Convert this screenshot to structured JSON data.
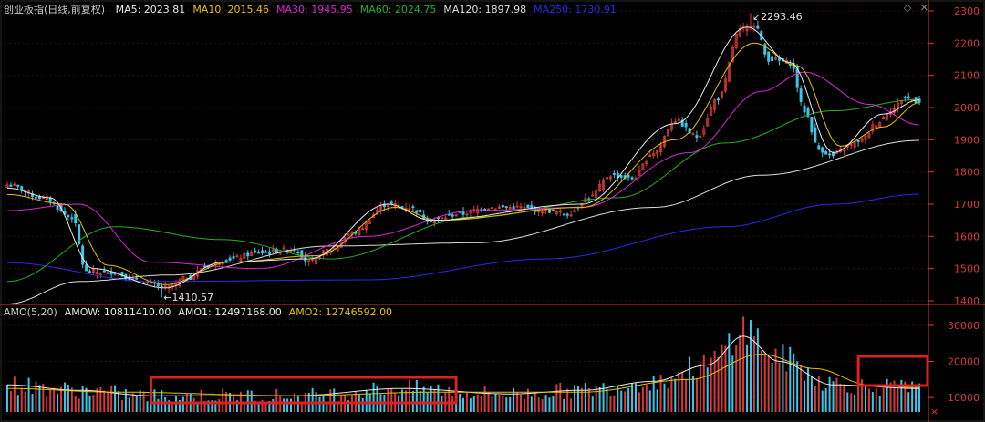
{
  "index_name": "创业板指",
  "period_label": "(日线,前复权)",
  "ma_legend": [
    {
      "label": "MA5: 2023.81",
      "color": "#e8e8e8"
    },
    {
      "label": "MA10: 2015.46",
      "color": "#e5c000"
    },
    {
      "label": "MA30: 1945.95",
      "color": "#d22ad2"
    },
    {
      "label": "MA60: 2024.75",
      "color": "#22b022"
    },
    {
      "label": "MA120: 1897.98",
      "color": "#dcdcdc"
    },
    {
      "label": "MA250: 1730.91",
      "color": "#2a2ae8"
    }
  ],
  "amo_legend": [
    {
      "label": "AMO(5,20)",
      "color": "#c8c8c8"
    },
    {
      "label": "AMOW: 10811410.00",
      "color": "#e8e8e8"
    },
    {
      "label": "AMO1: 12497168.00",
      "color": "#e8e8e8"
    },
    {
      "label": "AMO2: 12746592.00",
      "color": "#e5c000"
    }
  ],
  "icons": [
    "diamond-icon",
    "close-icon"
  ],
  "icon_glyphs": {
    "diamond": "◇",
    "close": "✕"
  },
  "annotations": {
    "high": "2293.46",
    "low": "1410.57"
  },
  "colors": {
    "up": "#d63a3a",
    "down": "#3ec5e8",
    "axis": "#d63a3a",
    "grid": "#3a0d0d",
    "highlight": "#e02020"
  },
  "chart_data": [
    {
      "type": "candlestick",
      "title": "创业板指 (日线,前复权)",
      "ylim": [
        1400,
        2300
      ],
      "yticks": [
        1400,
        1500,
        1600,
        1700,
        1800,
        1900,
        2000,
        2100,
        2200,
        2300
      ],
      "keypoints_close": [
        {
          "i": 0,
          "v": 1760
        },
        {
          "i": 10,
          "v": 1720
        },
        {
          "i": 18,
          "v": 1660
        },
        {
          "i": 22,
          "v": 1490
        },
        {
          "i": 28,
          "v": 1490
        },
        {
          "i": 38,
          "v": 1460
        },
        {
          "i": 44,
          "v": 1440
        },
        {
          "i": 50,
          "v": 1470
        },
        {
          "i": 56,
          "v": 1510
        },
        {
          "i": 62,
          "v": 1530
        },
        {
          "i": 70,
          "v": 1550
        },
        {
          "i": 80,
          "v": 1560
        },
        {
          "i": 84,
          "v": 1520
        },
        {
          "i": 90,
          "v": 1560
        },
        {
          "i": 96,
          "v": 1610
        },
        {
          "i": 106,
          "v": 1700
        },
        {
          "i": 112,
          "v": 1690
        },
        {
          "i": 118,
          "v": 1650
        },
        {
          "i": 126,
          "v": 1670
        },
        {
          "i": 134,
          "v": 1690
        },
        {
          "i": 142,
          "v": 1690
        },
        {
          "i": 150,
          "v": 1680
        },
        {
          "i": 156,
          "v": 1670
        },
        {
          "i": 162,
          "v": 1720
        },
        {
          "i": 168,
          "v": 1790
        },
        {
          "i": 174,
          "v": 1780
        },
        {
          "i": 180,
          "v": 1860
        },
        {
          "i": 186,
          "v": 1960
        },
        {
          "i": 192,
          "v": 1910
        },
        {
          "i": 198,
          "v": 2030
        },
        {
          "i": 204,
          "v": 2240
        },
        {
          "i": 208,
          "v": 2260
        },
        {
          "i": 212,
          "v": 2150
        },
        {
          "i": 218,
          "v": 2140
        },
        {
          "i": 222,
          "v": 1990
        },
        {
          "i": 226,
          "v": 1870
        },
        {
          "i": 230,
          "v": 1850
        },
        {
          "i": 234,
          "v": 1880
        },
        {
          "i": 238,
          "v": 1900
        },
        {
          "i": 242,
          "v": 1950
        },
        {
          "i": 246,
          "v": 1990
        },
        {
          "i": 250,
          "v": 2030
        },
        {
          "i": 254,
          "v": 2020
        }
      ],
      "high_point": {
        "value": 2293.46,
        "index": 207
      },
      "low_point": {
        "value": 1410.57,
        "index": 43
      },
      "moving_averages": [
        {
          "name": "MA250",
          "keypoints": [
            {
              "i": 0,
              "v": 1518
            },
            {
              "i": 40,
              "v": 1460
            },
            {
              "i": 100,
              "v": 1465
            },
            {
              "i": 150,
              "v": 1530
            },
            {
              "i": 200,
              "v": 1630
            },
            {
              "i": 230,
              "v": 1700
            },
            {
              "i": 254,
              "v": 1731
            }
          ]
        },
        {
          "name": "MA120",
          "keypoints": [
            {
              "i": 0,
              "v": 1390
            },
            {
              "i": 20,
              "v": 1460
            },
            {
              "i": 45,
              "v": 1480
            },
            {
              "i": 90,
              "v": 1570
            },
            {
              "i": 130,
              "v": 1580
            },
            {
              "i": 180,
              "v": 1690
            },
            {
              "i": 210,
              "v": 1790
            },
            {
              "i": 254,
              "v": 1898
            }
          ]
        },
        {
          "name": "MA60",
          "keypoints": [
            {
              "i": 0,
              "v": 1460
            },
            {
              "i": 30,
              "v": 1630
            },
            {
              "i": 60,
              "v": 1590
            },
            {
              "i": 90,
              "v": 1530
            },
            {
              "i": 130,
              "v": 1660
            },
            {
              "i": 170,
              "v": 1720
            },
            {
              "i": 200,
              "v": 1890
            },
            {
              "i": 230,
              "v": 1990
            },
            {
              "i": 254,
              "v": 2025
            }
          ]
        },
        {
          "name": "MA30",
          "keypoints": [
            {
              "i": 0,
              "v": 1680
            },
            {
              "i": 20,
              "v": 1700
            },
            {
              "i": 40,
              "v": 1520
            },
            {
              "i": 70,
              "v": 1500
            },
            {
              "i": 100,
              "v": 1600
            },
            {
              "i": 130,
              "v": 1680
            },
            {
              "i": 160,
              "v": 1690
            },
            {
              "i": 190,
              "v": 1860
            },
            {
              "i": 210,
              "v": 2050
            },
            {
              "i": 222,
              "v": 2110
            },
            {
              "i": 240,
              "v": 2010
            },
            {
              "i": 254,
              "v": 1946
            }
          ]
        },
        {
          "name": "MA10",
          "keypoints": [
            {
              "i": 0,
              "v": 1730
            },
            {
              "i": 16,
              "v": 1700
            },
            {
              "i": 28,
              "v": 1510
            },
            {
              "i": 44,
              "v": 1450
            },
            {
              "i": 62,
              "v": 1520
            },
            {
              "i": 86,
              "v": 1540
            },
            {
              "i": 108,
              "v": 1690
            },
            {
              "i": 120,
              "v": 1650
            },
            {
              "i": 160,
              "v": 1690
            },
            {
              "i": 186,
              "v": 1900
            },
            {
              "i": 208,
              "v": 2200
            },
            {
              "i": 220,
              "v": 2130
            },
            {
              "i": 232,
              "v": 1880
            },
            {
              "i": 244,
              "v": 1940
            },
            {
              "i": 254,
              "v": 2015
            }
          ]
        },
        {
          "name": "MA5",
          "keypoints": [
            {
              "i": 0,
              "v": 1750
            },
            {
              "i": 12,
              "v": 1720
            },
            {
              "i": 24,
              "v": 1500
            },
            {
              "i": 44,
              "v": 1440
            },
            {
              "i": 60,
              "v": 1520
            },
            {
              "i": 84,
              "v": 1530
            },
            {
              "i": 106,
              "v": 1700
            },
            {
              "i": 118,
              "v": 1650
            },
            {
              "i": 160,
              "v": 1700
            },
            {
              "i": 186,
              "v": 1950
            },
            {
              "i": 206,
              "v": 2250
            },
            {
              "i": 218,
              "v": 2140
            },
            {
              "i": 230,
              "v": 1860
            },
            {
              "i": 244,
              "v": 1980
            },
            {
              "i": 254,
              "v": 2024
            }
          ]
        }
      ]
    },
    {
      "type": "bar",
      "title": "AMO(5,20)",
      "ylim": [
        6000,
        33000
      ],
      "yticks": [
        10000,
        20000,
        30000
      ],
      "ytick_labels": [
        "10000",
        "20000",
        "30000"
      ],
      "ytick_prefix": "×",
      "keypoints": [
        {
          "i": 0,
          "v": 13500
        },
        {
          "i": 20,
          "v": 12000
        },
        {
          "i": 40,
          "v": 10500
        },
        {
          "i": 80,
          "v": 10500
        },
        {
          "i": 110,
          "v": 12500
        },
        {
          "i": 140,
          "v": 11000
        },
        {
          "i": 160,
          "v": 12000
        },
        {
          "i": 180,
          "v": 14500
        },
        {
          "i": 195,
          "v": 19000
        },
        {
          "i": 205,
          "v": 29000
        },
        {
          "i": 215,
          "v": 21000
        },
        {
          "i": 230,
          "v": 14000
        },
        {
          "i": 240,
          "v": 13000
        },
        {
          "i": 254,
          "v": 12500
        }
      ],
      "lines": [
        {
          "name": "AMO1",
          "keypoints": [
            {
              "i": 0,
              "v": 13500
            },
            {
              "i": 20,
              "v": 12000
            },
            {
              "i": 40,
              "v": 10500
            },
            {
              "i": 80,
              "v": 10500
            },
            {
              "i": 110,
              "v": 12500
            },
            {
              "i": 140,
              "v": 11000
            },
            {
              "i": 160,
              "v": 12000
            },
            {
              "i": 180,
              "v": 14500
            },
            {
              "i": 195,
              "v": 19000
            },
            {
              "i": 205,
              "v": 27000
            },
            {
              "i": 215,
              "v": 20000
            },
            {
              "i": 230,
              "v": 13500
            },
            {
              "i": 254,
              "v": 12500
            }
          ]
        },
        {
          "name": "AMO2",
          "keypoints": [
            {
              "i": 0,
              "v": 12500
            },
            {
              "i": 30,
              "v": 11500
            },
            {
              "i": 80,
              "v": 10500
            },
            {
              "i": 120,
              "v": 11500
            },
            {
              "i": 160,
              "v": 11500
            },
            {
              "i": 190,
              "v": 15000
            },
            {
              "i": 210,
              "v": 22000
            },
            {
              "i": 225,
              "v": 18000
            },
            {
              "i": 240,
              "v": 13500
            },
            {
              "i": 254,
              "v": 12700
            }
          ]
        }
      ]
    }
  ]
}
